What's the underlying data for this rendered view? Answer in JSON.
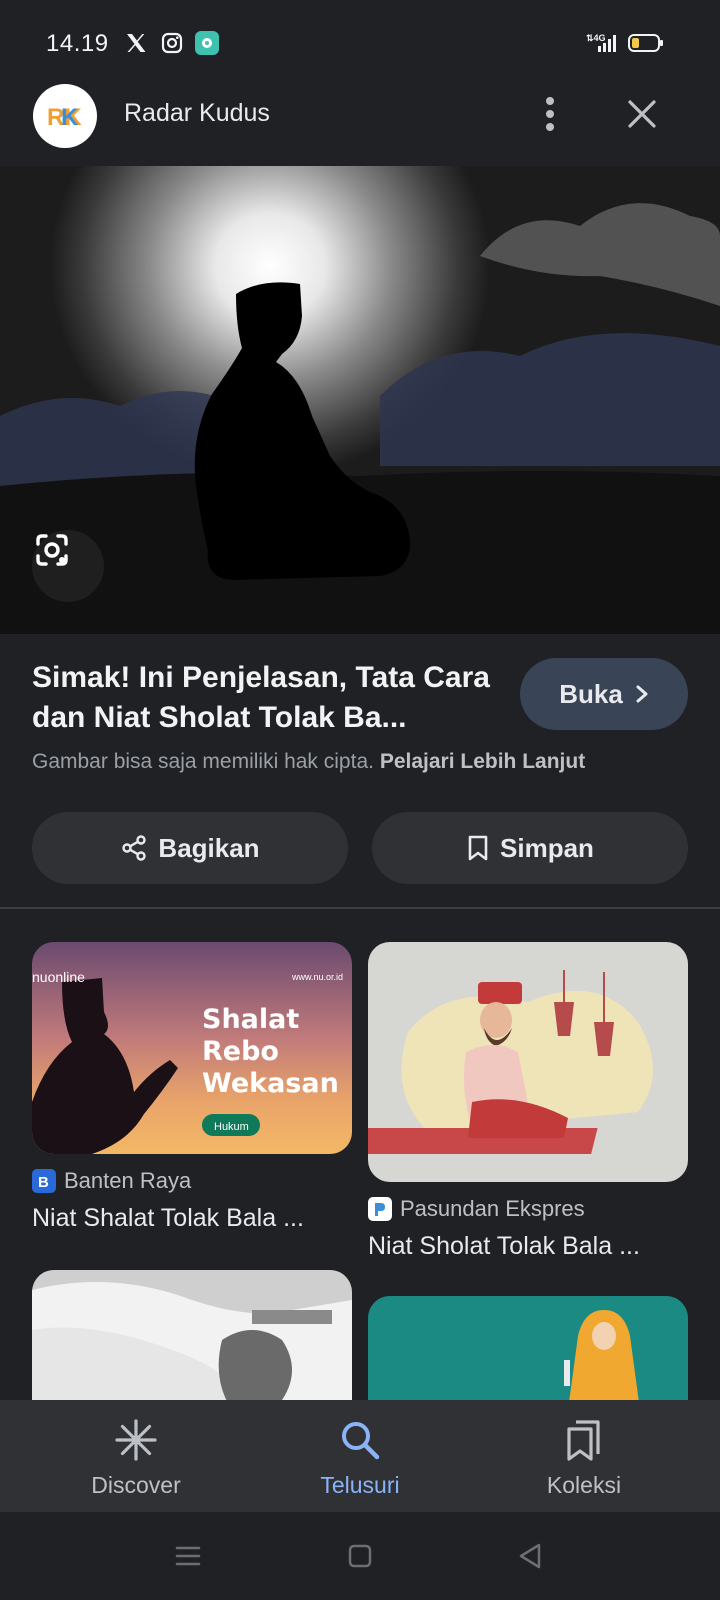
{
  "status_bar": {
    "time": "14.19",
    "network": "4G",
    "app_accent": "#3ec1ae",
    "battery_color": "#f2c94c"
  },
  "header": {
    "site_name": "Radar Kudus",
    "logo_text": "RK",
    "icons": {
      "more": "more-vert-icon",
      "close": "close-icon"
    }
  },
  "hero": {
    "lens_icon": "google-lens-icon"
  },
  "article": {
    "title": "Simak! Ini Penjelasan, Tata Cara dan Niat Sholat Tolak Ba...",
    "open_label": "Buka",
    "copyright_text": "Gambar bisa saja memiliki hak cipta.",
    "learn_more": "Pelajari Lebih Lanjut"
  },
  "actions": {
    "share_label": "Bagikan",
    "save_label": "Simpan"
  },
  "results": [
    {
      "source": "Banten Raya",
      "title": "Niat Shalat Tolak Bala ...",
      "image_text": {
        "brand": "nuonline",
        "url": "www.nu.or.id",
        "line1": "Shalat",
        "line2": "Rebo",
        "line3": "Wekasan",
        "tag": "Hukum"
      }
    },
    {
      "source": "Pasundan Ekspres",
      "title": "Niat Sholat Tolak Bala ..."
    }
  ],
  "bottom_nav": [
    {
      "label": "Discover",
      "icon": "asterisk-icon",
      "active": false
    },
    {
      "label": "Telusuri",
      "icon": "search-icon",
      "active": true
    },
    {
      "label": "Koleksi",
      "icon": "collections-icon",
      "active": false
    }
  ],
  "colors": {
    "background": "#202124",
    "surface": "#303134",
    "open_button": "#394457",
    "accent": "#8ab4f8"
  }
}
